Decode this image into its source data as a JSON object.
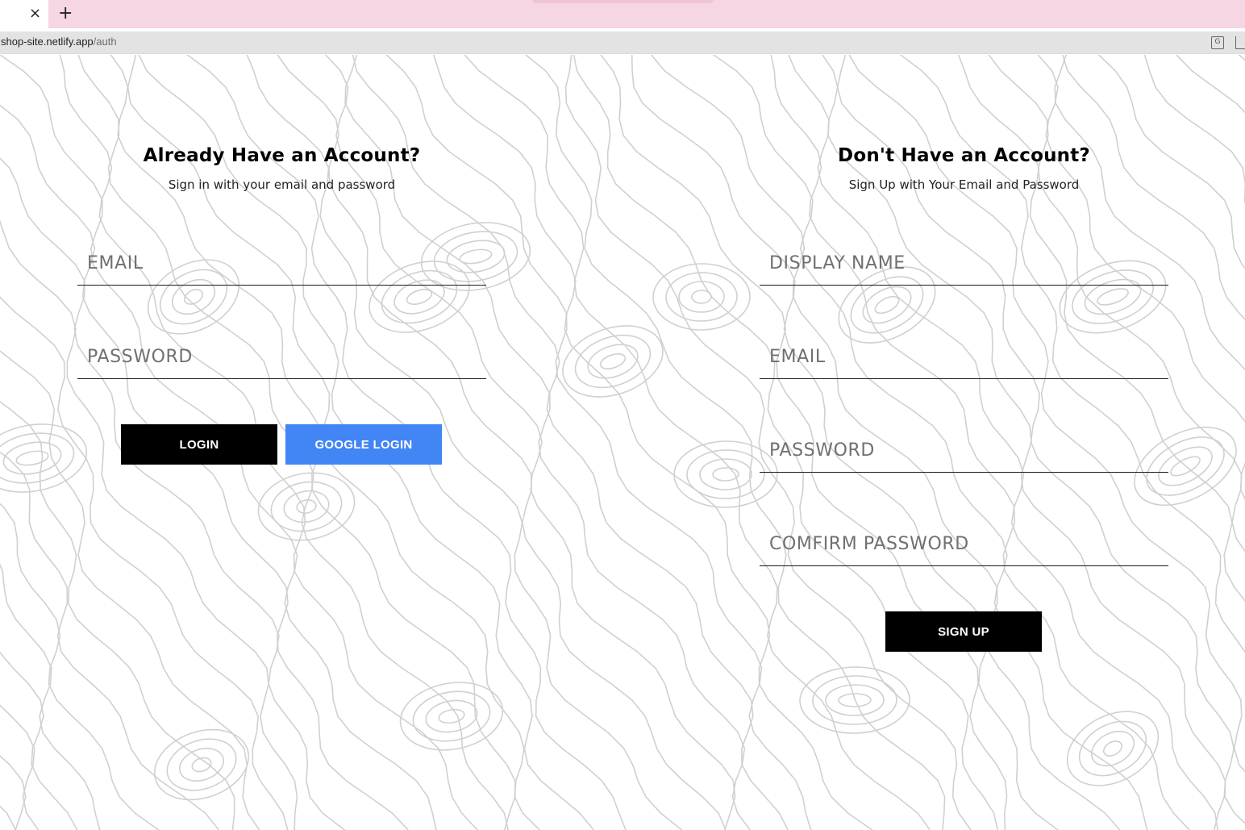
{
  "browser": {
    "tab_close": "×",
    "new_tab": "+",
    "url_host": "shop-site.netlify.app",
    "url_path": "/auth"
  },
  "sign_in": {
    "title": "Already Have an Account?",
    "subtitle": "Sign in with your email and password",
    "email_placeholder": "EMAIL",
    "password_placeholder": "PASSWORD",
    "login_button": "LOGIN",
    "google_button": "GOOGLE LOGIN"
  },
  "sign_up": {
    "title": "Don't Have an Account?",
    "subtitle": "Sign Up with Your Email and Password",
    "display_name_placeholder": "DISPLAY NAME",
    "email_placeholder": "EMAIL",
    "password_placeholder": "PASSWORD",
    "confirm_password_placeholder": "COMFIRM PASSWORD",
    "signup_button": "SIGN UP"
  },
  "colors": {
    "tabbar": "#f6d6e4",
    "primary_button": "#000000",
    "google_button": "#4285f4",
    "topo_lines": "#d0d0d0"
  }
}
